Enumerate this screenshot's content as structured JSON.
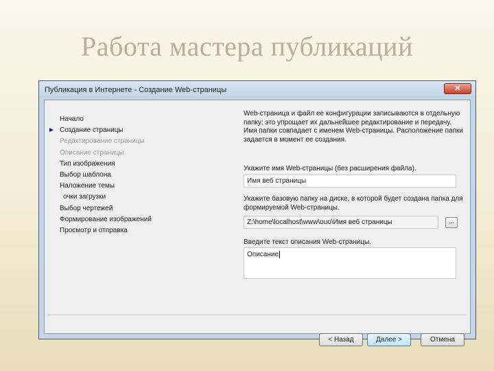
{
  "slide": {
    "title": "Работа мастера публикаций"
  },
  "dialog": {
    "title": "Публикация в Интернете - Создание Web-страницы",
    "close_glyph": "✕",
    "steps": [
      {
        "label": "Начало",
        "state": "normal"
      },
      {
        "label": "Создание страницы",
        "state": "current"
      },
      {
        "label": "Редактирование страницы",
        "state": "disabled"
      },
      {
        "label": "Описание страницы",
        "state": "disabled"
      },
      {
        "label": "Тип изображения",
        "state": "normal"
      },
      {
        "label": "Выбор шаблона",
        "state": "normal"
      },
      {
        "label": "Наложение темы",
        "state": "normal"
      },
      {
        "label": "очки загрузки",
        "state": "normal"
      },
      {
        "label": "Выбор чертежей",
        "state": "normal"
      },
      {
        "label": "Формирование изображений",
        "state": "normal"
      },
      {
        "label": "Просмотр и отправка",
        "state": "normal"
      }
    ],
    "current_marker": "►",
    "info_text": "Web-страница и файл ее конфигурации записываются в отдельную папку; это упрощает их дальнейшее редактирование и передачу. Имя папки совпадает с именем Web-страницы. Расположение папки задается в момент ее создания.",
    "name_label": "Укажите имя Web-страницы (без расширения файла).",
    "name_value": "Имя веб страницы",
    "folder_label": "Укажите базовую папку на диске, в которой будет создана папка для формируемой Web-страницы.",
    "folder_value": "Z:\\home\\localhost\\www\\ouo\\Имя веб страницы",
    "browse_label": "...",
    "description_label": "Введите текст описания Web-страницы.",
    "description_value": "Описание",
    "buttons": {
      "back": "< Назад",
      "next": "Далее >",
      "cancel": "Отмена"
    }
  }
}
